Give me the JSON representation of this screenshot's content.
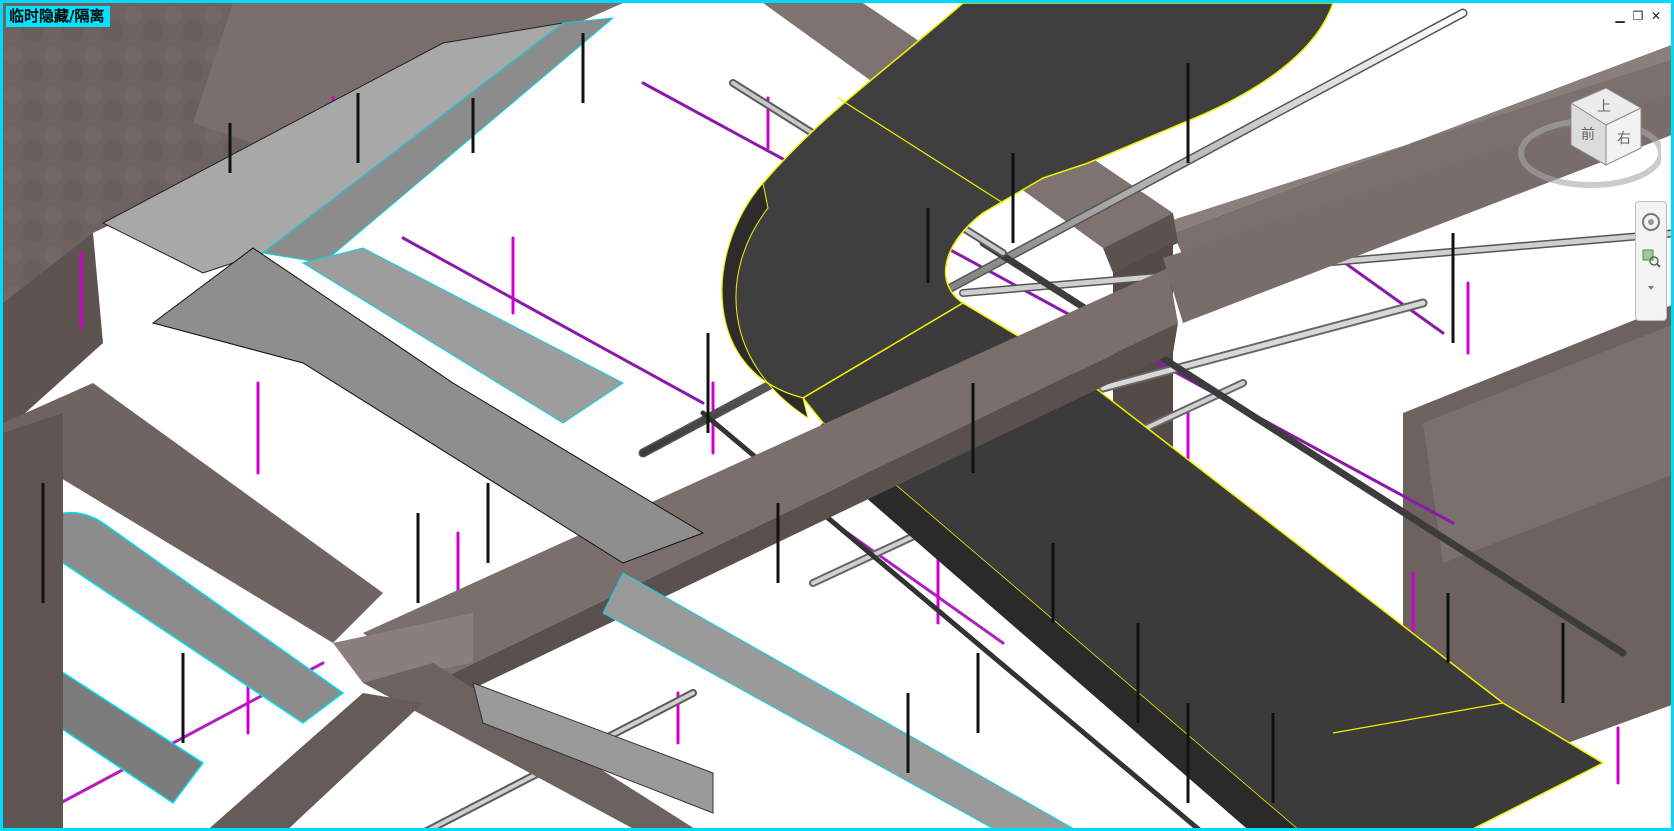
{
  "window": {
    "mode_label": "临时隐藏/隔离",
    "minimize_glyph": "▁",
    "restore_glyph": "❐",
    "close_glyph": "✕"
  },
  "viewcube": {
    "face_labels": [
      "上",
      "右",
      "前"
    ],
    "icon": "viewcube-icon"
  },
  "navigation_bar": {
    "icons": [
      "steering-wheel-icon",
      "zoom-region-icon",
      "dropdown-arrow-icon"
    ]
  },
  "colors": {
    "viewport_border": "#00d8ff",
    "mode_label_bg": "#00e5ff",
    "concrete": "#6f6462",
    "duct_dark": "#4a4a4a",
    "duct_light": "#9b9b9b",
    "selection_outline": "#f2f200",
    "pipe_magenta": "#d000d0",
    "pipe_purple": "#8a1aa8",
    "pipe_steel": "#b8b8b8",
    "cyan_edge": "#00e0f0"
  }
}
